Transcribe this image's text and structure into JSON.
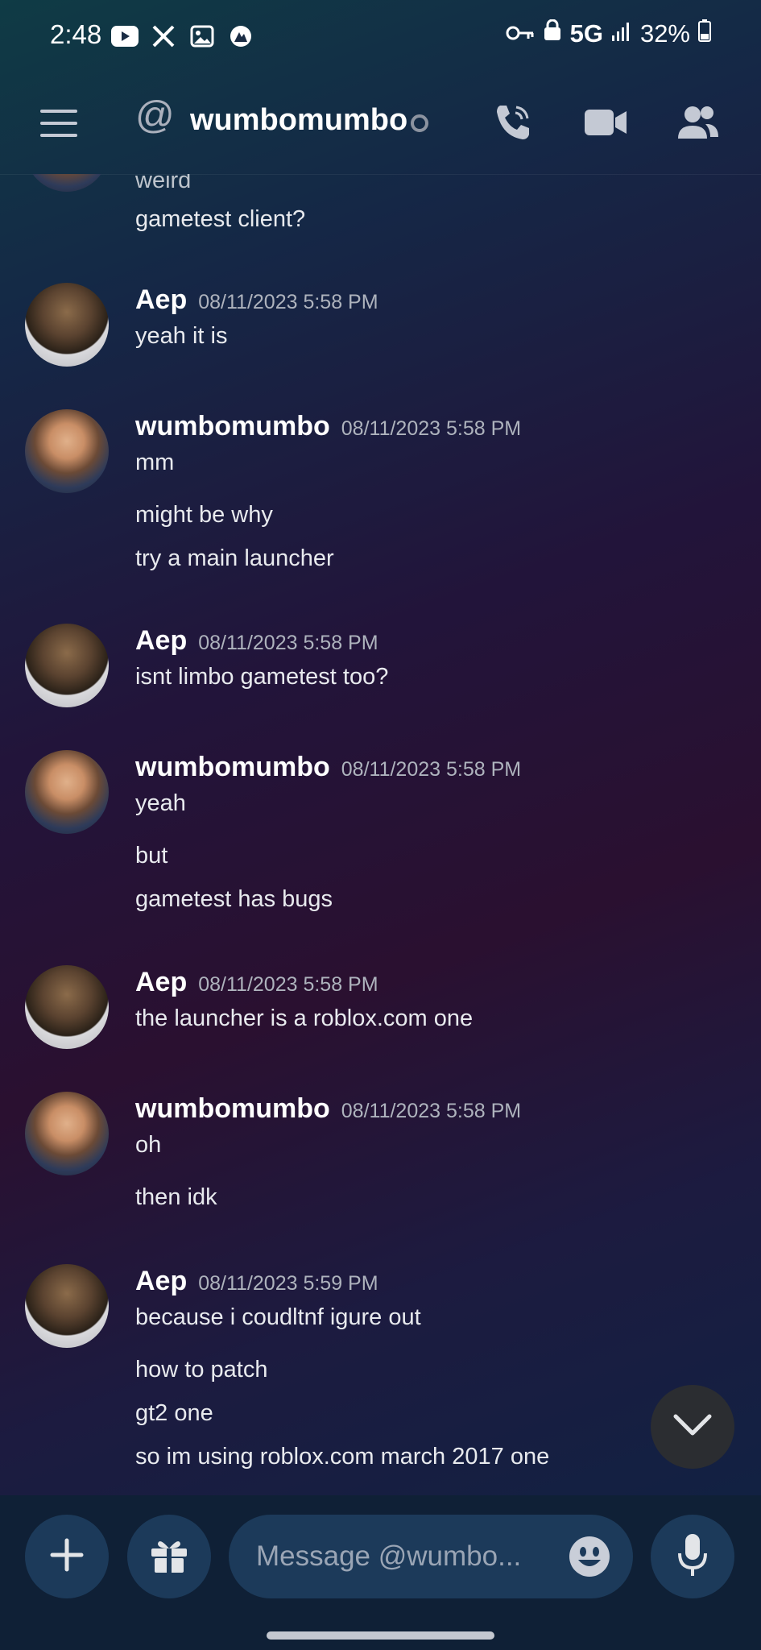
{
  "status_bar": {
    "time": "2:48",
    "network": "5G",
    "battery": "32%"
  },
  "header": {
    "channel_name": "wumbomumbo"
  },
  "messages": [
    {
      "lines": [
        "weird",
        "gametest client?"
      ]
    },
    {
      "author": "Aep",
      "timestamp": "08/11/2023 5:58 PM",
      "lines": [
        "yeah it is"
      ]
    },
    {
      "author": "wumbomumbo",
      "timestamp": "08/11/2023 5:58 PM",
      "lines": [
        "mm",
        "might be why",
        "try a main launcher"
      ]
    },
    {
      "author": "Aep",
      "timestamp": "08/11/2023 5:58 PM",
      "lines": [
        "isnt limbo gametest too?"
      ]
    },
    {
      "author": "wumbomumbo",
      "timestamp": "08/11/2023 5:58 PM",
      "lines": [
        "yeah",
        "but",
        "gametest has bugs"
      ]
    },
    {
      "author": "Aep",
      "timestamp": "08/11/2023 5:58 PM",
      "lines": [
        "the launcher is a roblox.com one"
      ]
    },
    {
      "author": "wumbomumbo",
      "timestamp": "08/11/2023 5:58 PM",
      "lines": [
        "oh",
        "then idk"
      ]
    },
    {
      "author": "Aep",
      "timestamp": "08/11/2023 5:59 PM",
      "lines": [
        "because i coudltnf igure out",
        "how to patch",
        "gt2 one",
        "so im using roblox.com march 2017 one"
      ]
    }
  ],
  "composer": {
    "placeholder": "Message @wumbo..."
  },
  "icons": {
    "status_left": [
      "youtube-icon",
      "x-icon",
      "gallery-icon",
      "vpn-icon"
    ],
    "status_right": [
      "key-icon",
      "vpn-lock-icon",
      "signal-icon",
      "battery-icon"
    ],
    "header": [
      "hamburger-icon",
      "at-icon",
      "call-icon",
      "video-icon",
      "members-icon"
    ],
    "composer": [
      "plus-icon",
      "gift-icon",
      "emoji-icon",
      "mic-icon"
    ],
    "jump": "chevron-down-icon"
  },
  "colors": {
    "header_text": "#ffffff",
    "timestamp": "#aeb3bd",
    "composer_bg": "#0f2036",
    "input_bg": "#1c3a5a"
  }
}
